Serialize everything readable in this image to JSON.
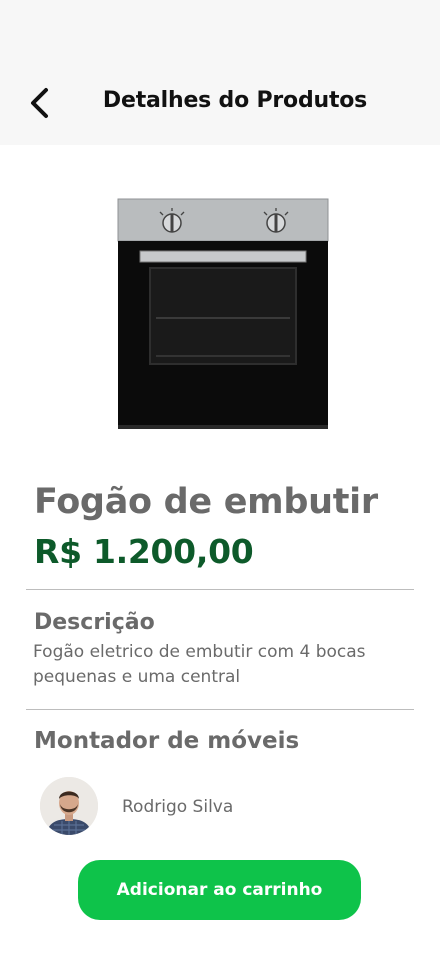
{
  "header": {
    "title": "Detalhes do Produtos",
    "back_icon": "chevron-left-icon"
  },
  "product": {
    "image": "built-in-oven-image",
    "name": "Fogão de embutir",
    "price": "R$ 1.200,00"
  },
  "description": {
    "title": "Descrição",
    "text": "Fogão eletrico de embutir com 4 bocas pequenas e uma central"
  },
  "assembler": {
    "title": "Montador de móveis",
    "name": "Rodrigo Silva"
  },
  "cart_button": {
    "label": "Adicionar ao carrinho"
  },
  "colors": {
    "header_bg": "#f7f7f7",
    "price": "#0d5a2a",
    "button": "#0ec34a",
    "text_gray": "#6a6a6a"
  }
}
